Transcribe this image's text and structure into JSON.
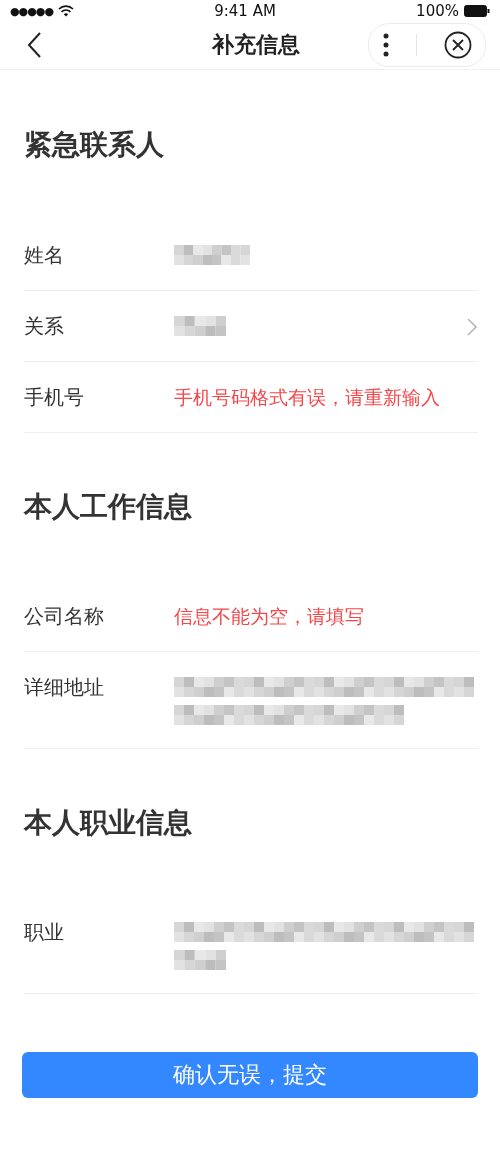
{
  "status_bar": {
    "signal": "●●●●●",
    "time": "9:41 AM",
    "battery": "100%"
  },
  "nav": {
    "title": "补充信息"
  },
  "sections": [
    {
      "title": "紧急联系人",
      "rows": [
        {
          "label": "姓名",
          "kind": "blurred",
          "chevron": false
        },
        {
          "label": "关系",
          "kind": "blurred",
          "chevron": true
        },
        {
          "label": "手机号",
          "kind": "error",
          "error": "手机号码格式有误，请重新输入",
          "chevron": false
        }
      ]
    },
    {
      "title": "本人工作信息",
      "rows": [
        {
          "label": "公司名称",
          "kind": "error",
          "error": "信息不能为空，请填写",
          "chevron": false
        },
        {
          "label": "详细地址",
          "kind": "paragraph",
          "chevron": false
        }
      ]
    },
    {
      "title": "本人职业信息",
      "rows": [
        {
          "label": "职业",
          "kind": "paragraph",
          "chevron": false
        }
      ]
    }
  ],
  "submit": {
    "label": "确认无误，提交"
  }
}
